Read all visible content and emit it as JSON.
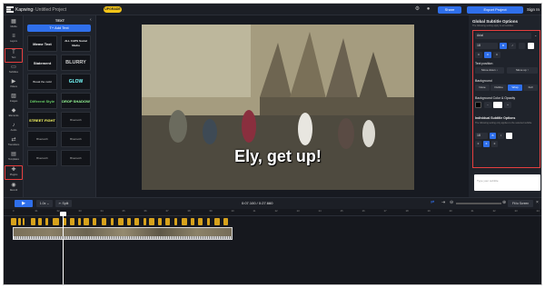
{
  "app": {
    "brand": "Kapwing",
    "project": "› Untitled Project",
    "upgrade": "UPGRADE",
    "share": "Share",
    "export": "Export Project",
    "signin": "Sign In"
  },
  "left_nav": [
    {
      "label": "Media",
      "icon": "media-icon"
    },
    {
      "label": "Layers",
      "icon": "layers-icon"
    },
    {
      "label": "Text",
      "icon": "text-icon"
    },
    {
      "label": "Subtitles",
      "icon": "subtitles-icon"
    },
    {
      "label": "Videos",
      "icon": "videos-icon"
    },
    {
      "label": "Images",
      "icon": "images-icon"
    },
    {
      "label": "Elements",
      "icon": "elements-icon"
    },
    {
      "label": "Audio",
      "icon": "audio-icon"
    },
    {
      "label": "Transitions",
      "icon": "transitions-icon"
    },
    {
      "label": "Templates",
      "icon": "templates-icon"
    },
    {
      "label": "Plugins",
      "icon": "plugins-icon"
    },
    {
      "label": "Record",
      "icon": "record-icon"
    }
  ],
  "text_panel": {
    "title": "TEXT",
    "add_text": "Add Text",
    "presets": [
      "Meme Text",
      "ALL CAPS Social Media",
      "Statement",
      "BLURRY",
      "Break the mold",
      "GLOW",
      "Different Style",
      "DROP SHADOW",
      "STREET FIGHT",
      "Bluetooth",
      "Bluetooth",
      "Bluetooth",
      "Bluetooth",
      "Bluetooth"
    ]
  },
  "video": {
    "subtitle": "Ely, get up!"
  },
  "right_panel": {
    "title": "Global Subtitle Options",
    "subtitle": "The following setting apply to all subtitles",
    "font": "Arial",
    "font_size": "18",
    "text_position_label": "Text position",
    "move_down": "Move down",
    "move_up": "Move up",
    "background_label": "Background",
    "bg_options": [
      "None",
      "Outline",
      "Wrap",
      "Full"
    ],
    "bg_selected": "Wrap",
    "bg_color_label": "Background Color & Opacity",
    "individual_title": "Individual Subtitle Options",
    "individual_sub": "The following setting only applies to the selected subtitle",
    "ind_font_size": "18",
    "preview_placeholder": "Type your subtitle"
  },
  "timeline": {
    "speed": "1.0x",
    "split": "Split",
    "timecode": "0:07.100 / 0:27.660",
    "fit": "Fit to Screen",
    "ticks": [
      "0",
      ":01",
      ":02",
      ":03",
      ":04",
      ":05",
      ":06",
      ":07",
      ":08",
      ":09",
      ":10",
      ":11",
      ":12",
      ":13",
      ":14",
      ":15",
      ":16",
      ":17",
      ":18",
      ":19",
      ":20",
      ":21",
      ":22",
      ":23",
      ":24"
    ]
  },
  "colors": {
    "accent": "#2f6fea",
    "highlight": "#e53e3e",
    "subtitle_clip": "#d7a21c"
  }
}
